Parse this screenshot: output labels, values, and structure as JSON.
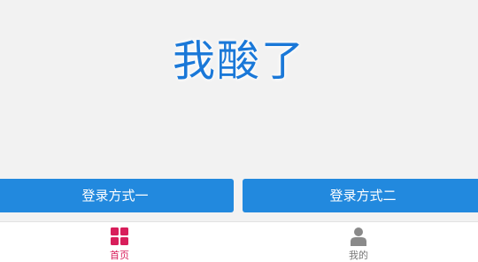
{
  "main": {
    "headline": "我酸了"
  },
  "buttons": {
    "login_one": "登录方式一",
    "login_two": "登录方式二"
  },
  "tabbar": {
    "items": [
      {
        "label": "首页",
        "icon": "grid-icon",
        "active": true,
        "color": "#d81e5b"
      },
      {
        "label": "我的",
        "icon": "user-icon",
        "active": false,
        "color": "#777777"
      }
    ]
  },
  "colors": {
    "accent": "#2289de",
    "headline": "#1a78d8",
    "background": "#f2f2f2",
    "active_tab": "#d81e5b",
    "inactive_tab": "#777777"
  }
}
